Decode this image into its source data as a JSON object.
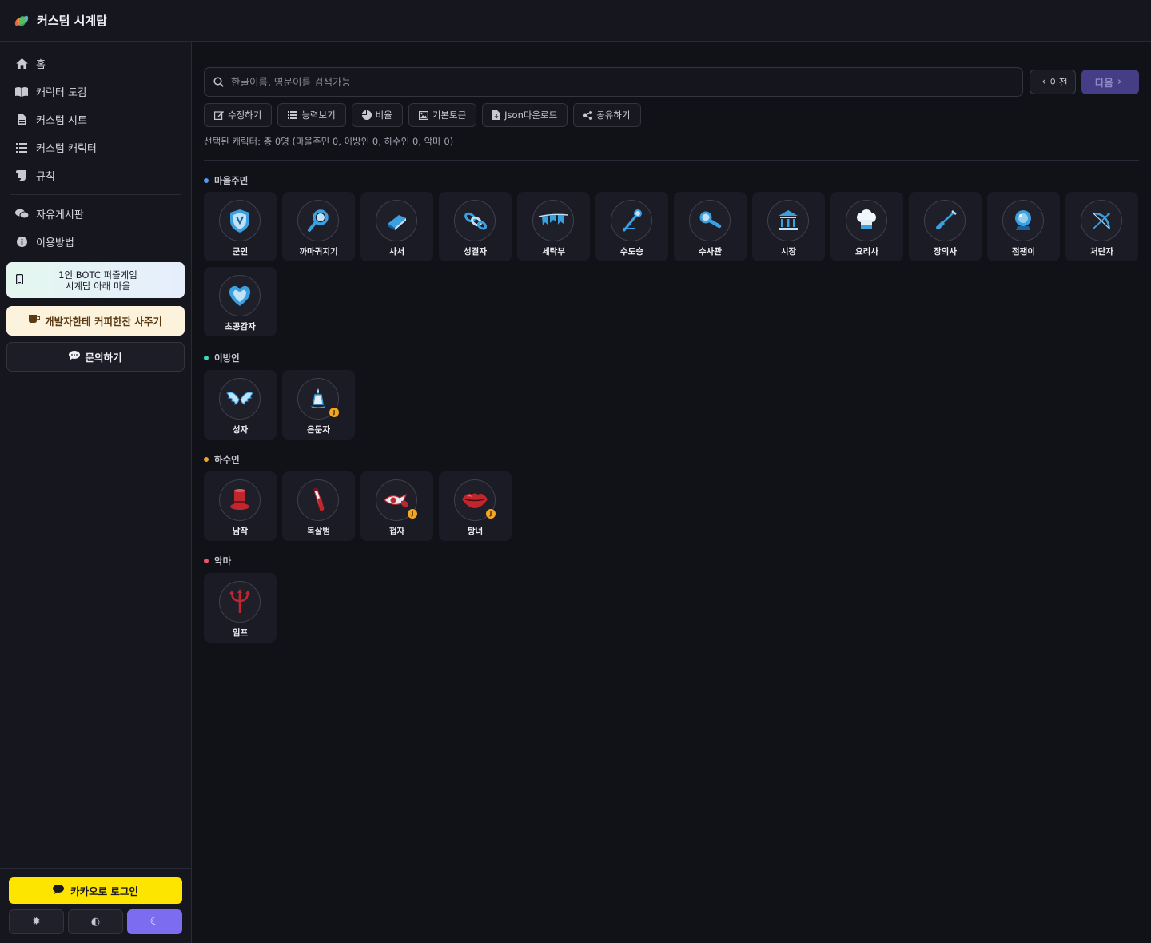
{
  "app": {
    "title": "커스텀 시계탑"
  },
  "sidebar": {
    "items": [
      {
        "label": "홈",
        "icon": "home-icon"
      },
      {
        "label": "캐릭터 도감",
        "icon": "book-icon"
      },
      {
        "label": "커스텀 시트",
        "icon": "document-icon"
      },
      {
        "label": "커스텀 캐릭터",
        "icon": "list-icon"
      },
      {
        "label": "규칙",
        "icon": "scroll-icon"
      }
    ],
    "items2": [
      {
        "label": "자유게시판",
        "icon": "comments-icon"
      },
      {
        "label": "이용방법",
        "icon": "info-icon"
      }
    ],
    "promo": {
      "line1": "1인 BOTC 퍼즐게임",
      "line2": "시계탑 아래 마을",
      "icon": "mobile-icon"
    },
    "coffee_label": "개발자한테 커피한잔 사주기",
    "inquiry_label": "문의하기",
    "kakao_label": "카카오로 로그인",
    "themes": [
      "settings-icon",
      "contrast-icon",
      "moon-icon"
    ],
    "active_theme": "moon-icon"
  },
  "search": {
    "placeholder": "한글이름, 영문이름 검색가능",
    "value": ""
  },
  "pager": {
    "prev_label": "이전",
    "next_label": "다음"
  },
  "toolbar": [
    {
      "label": "수정하기",
      "icon": "edit-icon"
    },
    {
      "label": "능력보기",
      "icon": "list-icon"
    },
    {
      "label": "비율",
      "icon": "pie-chart-icon"
    },
    {
      "label": "기본토큰",
      "icon": "image-icon"
    },
    {
      "label": "Json다운로드",
      "icon": "file-download-icon"
    },
    {
      "label": "공유하기",
      "icon": "share-icon"
    }
  ],
  "selection_info": "선택된 캐릭터: 총 0명 (마을주민 0, 이방인 0, 하수인 0, 악마 0)",
  "colors": {
    "townsfolk": "#4f9cf0",
    "outsider": "#3dd6c0",
    "minion": "#f4a623",
    "demon": "#e8546a",
    "good_token": "#3aa0e0",
    "evil_token": "#c0262e",
    "accent": "#7b6cf0"
  },
  "sections": [
    {
      "title": "마을주민",
      "team": "townsfolk",
      "characters": [
        {
          "name": "군인",
          "icon": "shield-icon"
        },
        {
          "name": "까마귀지기",
          "icon": "magnifier-icon"
        },
        {
          "name": "사서",
          "icon": "book-icon"
        },
        {
          "name": "성결자",
          "icon": "chain-icon"
        },
        {
          "name": "세탁부",
          "icon": "clothesline-icon"
        },
        {
          "name": "수도승",
          "icon": "staff-icon"
        },
        {
          "name": "수사관",
          "icon": "magnifier-icon"
        },
        {
          "name": "시장",
          "icon": "building-icon"
        },
        {
          "name": "요리사",
          "icon": "chef-hat-icon"
        },
        {
          "name": "장의사",
          "icon": "shovel-icon"
        },
        {
          "name": "점쟁이",
          "icon": "crystal-ball-icon"
        },
        {
          "name": "처단자",
          "icon": "bow-icon"
        },
        {
          "name": "초공감자",
          "icon": "heart-icon"
        }
      ]
    },
    {
      "title": "이방인",
      "team": "outsider",
      "characters": [
        {
          "name": "성자",
          "icon": "wings-icon"
        },
        {
          "name": "은둔자",
          "icon": "lantern-icon",
          "badge": "J"
        }
      ]
    },
    {
      "title": "하수인",
      "team": "minion",
      "characters": [
        {
          "name": "남작",
          "icon": "top-hat-icon"
        },
        {
          "name": "독살범",
          "icon": "poison-vial-icon"
        },
        {
          "name": "첩자",
          "icon": "spy-eye-icon",
          "badge": "J"
        },
        {
          "name": "탕녀",
          "icon": "lips-icon",
          "badge": "J"
        }
      ]
    },
    {
      "title": "악마",
      "team": "demon",
      "characters": [
        {
          "name": "임프",
          "icon": "trident-icon"
        }
      ]
    }
  ]
}
